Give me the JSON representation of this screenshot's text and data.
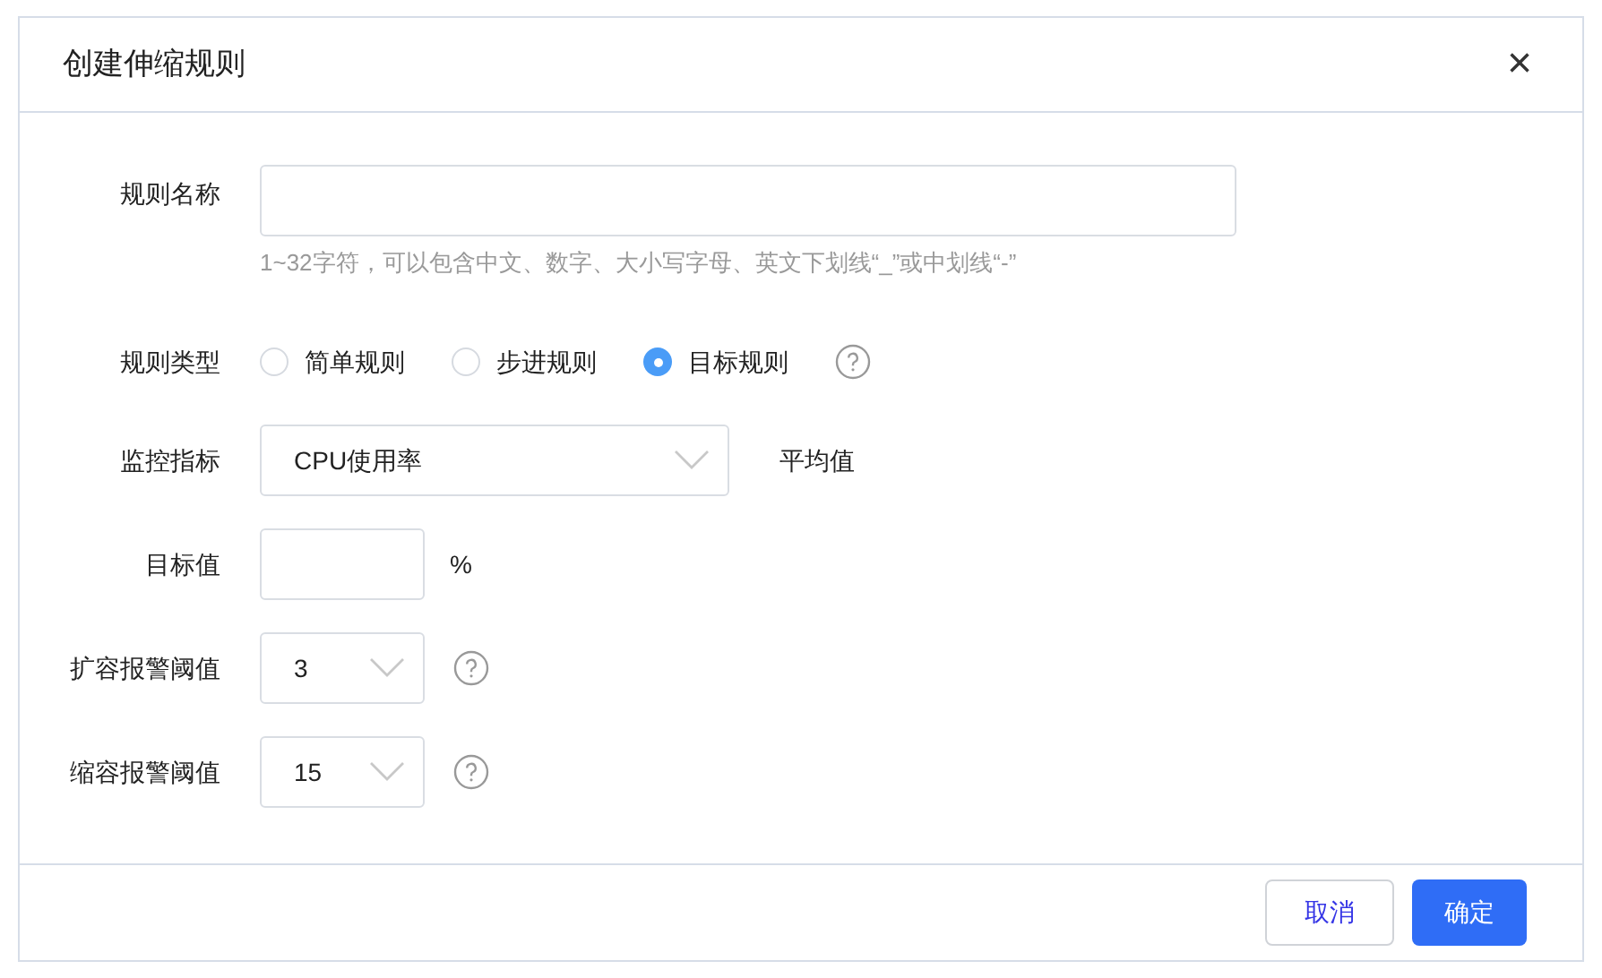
{
  "dialog": {
    "title": "创建伸缩规则",
    "close": "×"
  },
  "fields": [
    {
      "kind": "text",
      "label": "规则名称",
      "hint": "1~32字符，可以包含中文、数字、大小写字母、英文下划线“_”或中划线“-”"
    },
    {
      "kind": "radio",
      "label": "规则类型",
      "options": [
        {
          "label": "简单规则",
          "selected": false
        },
        {
          "label": "步进规则",
          "selected": false
        },
        {
          "label": "目标规则",
          "selected": true
        }
      ],
      "help": true
    },
    {
      "kind": "wide_select",
      "label": "监控指标",
      "value": "CPU使用率",
      "suffix": "平均值"
    },
    {
      "kind": "number",
      "label": "目标值",
      "suffix": "%"
    },
    {
      "kind": "select",
      "label": "扩容报警阈值",
      "value": "3",
      "help": true
    },
    {
      "kind": "select",
      "label": "缩容报警阈值",
      "value": "15",
      "help": true
    }
  ],
  "buttons": [
    {
      "label": "取消",
      "kind": "secondary"
    },
    {
      "label": "确定",
      "kind": "primary"
    }
  ]
}
